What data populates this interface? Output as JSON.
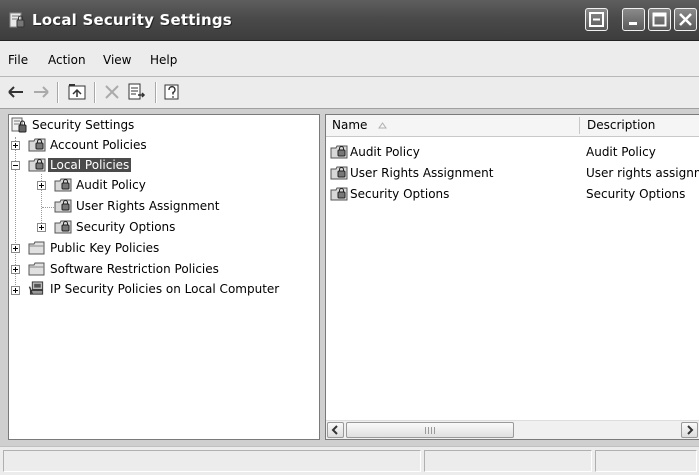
{
  "window": {
    "title": "Local Security Settings"
  },
  "menu": [
    {
      "label": "File"
    },
    {
      "label": "Action"
    },
    {
      "label": "View"
    },
    {
      "label": "Help"
    }
  ],
  "toolbar": {
    "buttons": [
      "back-arrow-icon",
      "forward-arrow-icon",
      "up-one-level-icon",
      "delete-icon",
      "export-list-icon",
      "help-icon"
    ]
  },
  "tree": {
    "root": {
      "label": "Security Settings",
      "icon": "security-settings-icon"
    },
    "items": [
      {
        "label": "Account Policies",
        "icon": "policy-folder-icon",
        "expander": "plus"
      },
      {
        "label": "Local Policies",
        "icon": "policy-folder-icon",
        "expander": "minus",
        "selected": true,
        "children": [
          {
            "label": "Audit Policy",
            "icon": "policy-folder-icon",
            "expander": "plus"
          },
          {
            "label": "User Rights Assignment",
            "icon": "policy-folder-icon"
          },
          {
            "label": "Security Options",
            "icon": "policy-folder-icon",
            "expander": "plus"
          }
        ]
      },
      {
        "label": "Public Key Policies",
        "icon": "folder-icon",
        "expander": "plus"
      },
      {
        "label": "Software Restriction Policies",
        "icon": "folder-icon",
        "expander": "plus"
      },
      {
        "label": "IP Security Policies on Local Computer",
        "icon": "ip-security-icon",
        "expander": "plus"
      }
    ]
  },
  "list": {
    "columns": [
      {
        "label": "Name",
        "sort": "ascending"
      },
      {
        "label": "Description"
      }
    ],
    "rows": [
      {
        "name": "Audit Policy",
        "description": "Audit Policy"
      },
      {
        "name": "User Rights Assignment",
        "description": "User rights assignment"
      },
      {
        "name": "Security Options",
        "description": "Security Options"
      }
    ]
  },
  "colors": {
    "titlebar": "#4a4a4a",
    "selection": "#4b4b4b",
    "chrome": "#ececec"
  }
}
